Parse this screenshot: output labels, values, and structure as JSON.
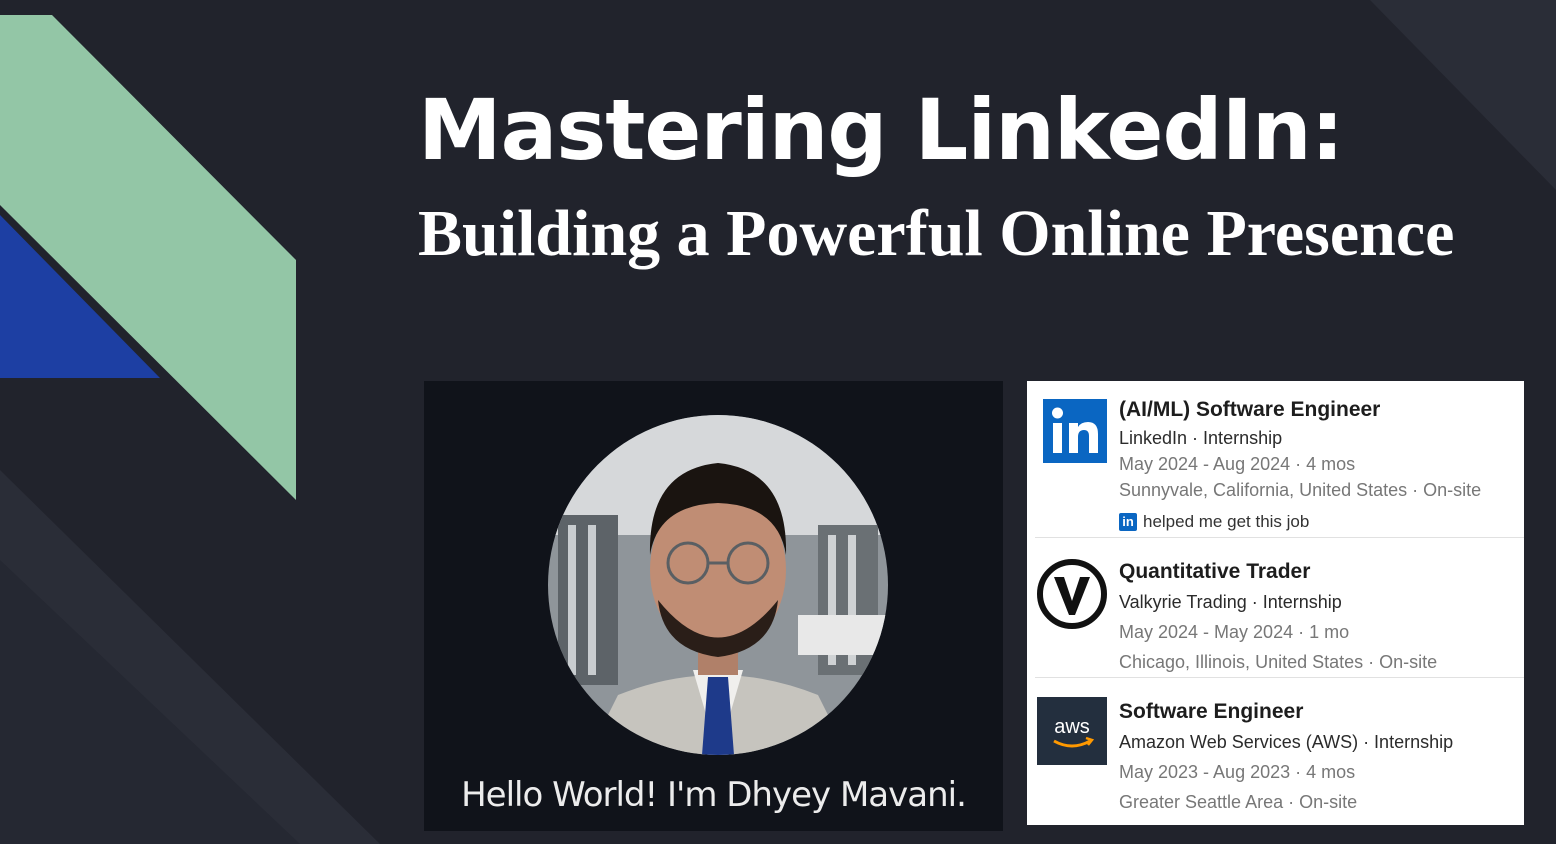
{
  "slide": {
    "title": "Mastering LinkedIn:",
    "subtitle": "Building a Powerful Online Presence"
  },
  "profile": {
    "caption": "Hello World! I'm Dhyey Mavani."
  },
  "experience": [
    {
      "logo": "linkedin-logo",
      "logo_text": "in",
      "role": "(AI/ML) Software Engineer",
      "company": "LinkedIn · Internship",
      "dates": "May 2024 - Aug 2024 · 4 mos",
      "location": "Sunnyvale, California, United States · On-site",
      "note_icon": "in",
      "note": "helped me get this job"
    },
    {
      "logo": "valkyrie-logo",
      "role": "Quantitative Trader",
      "company": "Valkyrie Trading · Internship",
      "dates": "May 2024 - May 2024 · 1 mo",
      "location": "Chicago, Illinois, United States · On-site"
    },
    {
      "logo": "aws-logo",
      "logo_text": "aws",
      "role": "Software Engineer",
      "company": "Amazon Web Services (AWS) · Internship",
      "dates": "May 2023 - Aug 2023 · 4 mos",
      "location": "Greater Seattle Area · On-site"
    }
  ],
  "colors": {
    "background": "#21232c",
    "mint_accent": "#93c6a6",
    "blue_accent": "#1d3fa3",
    "linkedin_blue": "#0a66c2",
    "aws_navy": "#232f3e",
    "aws_orange": "#ff9900"
  }
}
